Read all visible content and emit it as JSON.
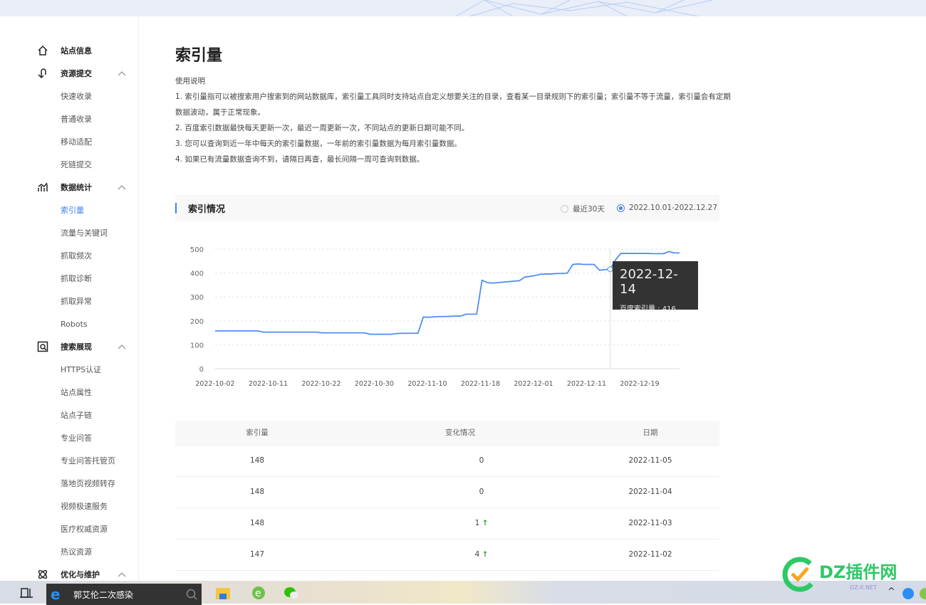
{
  "page": {
    "title": "索引量"
  },
  "sidebar": {
    "items": [
      {
        "label": "站点信息",
        "type": "main",
        "icon": "home-icon"
      },
      {
        "label": "资源提交",
        "type": "main",
        "icon": "submit-icon",
        "expanded": true
      },
      {
        "label": "快速收录",
        "type": "sub"
      },
      {
        "label": "普通收录",
        "type": "sub"
      },
      {
        "label": "移动适配",
        "type": "sub"
      },
      {
        "label": "死链提交",
        "type": "sub"
      },
      {
        "label": "数据统计",
        "type": "main",
        "icon": "stats-icon",
        "expanded": true
      },
      {
        "label": "索引量",
        "type": "sub",
        "active": true
      },
      {
        "label": "流量与关键词",
        "type": "sub"
      },
      {
        "label": "抓取频次",
        "type": "sub"
      },
      {
        "label": "抓取诊断",
        "type": "sub"
      },
      {
        "label": "抓取异常",
        "type": "sub"
      },
      {
        "label": "Robots",
        "type": "sub"
      },
      {
        "label": "搜索展现",
        "type": "main",
        "icon": "search-display-icon",
        "expanded": true
      },
      {
        "label": "HTTPS认证",
        "type": "sub"
      },
      {
        "label": "站点属性",
        "type": "sub"
      },
      {
        "label": "站点子链",
        "type": "sub"
      },
      {
        "label": "专业问答",
        "type": "sub"
      },
      {
        "label": "专业问答托管页",
        "type": "sub"
      },
      {
        "label": "落地页视频转存",
        "type": "sub"
      },
      {
        "label": "视频极速服务",
        "type": "sub"
      },
      {
        "label": "医疗权威资源",
        "type": "sub"
      },
      {
        "label": "热议资源",
        "type": "sub"
      },
      {
        "label": "优化与维护",
        "type": "main",
        "icon": "optimize-icon",
        "expanded": true
      }
    ]
  },
  "usage": {
    "heading": "使用说明",
    "lines": [
      "1. 索引量指可以被搜索用户搜索到的网站数据库，索引量工具同时支持站点自定义想要关注的目录，查看某一目录规则下的索引量；索引量不等于流量，索引量会有定期数据波动，属于正常现象。",
      "2. 百度索引数据最快每天更新一次，最迟一周更新一次，不同站点的更新日期可能不同。",
      "3. 您可以查询到近一年中每天的索引量数据，一年前的索引量数据为每月索引量数据。",
      "4. 如果已有流量数据查询不到，请隔日再查，最长间隔一周可查询到数据。"
    ]
  },
  "panel": {
    "title": "索引情况",
    "options": [
      {
        "label": "最近30天",
        "selected": false
      },
      {
        "label": "2022.10.01-2022.12.27",
        "selected": true
      }
    ]
  },
  "chart_data": {
    "type": "line",
    "color": "#4f8ef7",
    "ylim": [
      0,
      500
    ],
    "yticks": [
      0,
      100,
      200,
      300,
      400,
      500
    ],
    "xtick_labels": [
      "2022-10-02",
      "2022-10-11",
      "2022-10-22",
      "2022-10-30",
      "2022-11-10",
      "2022-11-18",
      "2022-12-01",
      "2022-12-11",
      "2022-12-19"
    ],
    "grid": true,
    "series": [
      {
        "name": "百度索引量",
        "values": [
          158,
          158,
          158,
          158,
          158,
          158,
          158,
          158,
          158,
          153,
          153,
          153,
          153,
          153,
          153,
          153,
          153,
          153,
          153,
          153,
          150,
          150,
          150,
          150,
          150,
          150,
          150,
          150,
          150,
          144,
          144,
          144,
          144,
          144,
          147,
          148,
          148,
          148,
          148,
          216,
          215,
          217,
          218,
          218,
          219,
          220,
          220,
          228,
          228,
          228,
          370,
          360,
          358,
          360,
          362,
          364,
          366,
          368,
          383,
          386,
          390,
          395,
          396,
          396,
          398,
          398,
          400,
          436,
          438,
          436,
          436,
          436,
          412,
          414,
          416,
          455,
          482,
          482,
          482,
          482,
          482,
          482,
          481,
          481,
          481,
          490,
          484,
          484
        ]
      }
    ],
    "tooltip": {
      "date": "2022-12-14",
      "label": "百度索引量 : 416",
      "index": 74
    }
  },
  "table": {
    "headers": [
      "索引量",
      "变化情况",
      "日期"
    ],
    "rows": [
      {
        "count": "148",
        "change": "0",
        "trend": "",
        "date": "2022-11-05"
      },
      {
        "count": "148",
        "change": "0",
        "trend": "",
        "date": "2022-11-04"
      },
      {
        "count": "148",
        "change": "1",
        "trend": "up",
        "date": "2022-11-03"
      },
      {
        "count": "147",
        "change": "4",
        "trend": "up",
        "date": "2022-11-02"
      }
    ]
  },
  "taskbar": {
    "search_text": "郭艾伦二次感染"
  },
  "watermark": {
    "text": "DZ插件网",
    "sub": "DZ-X.NET"
  }
}
